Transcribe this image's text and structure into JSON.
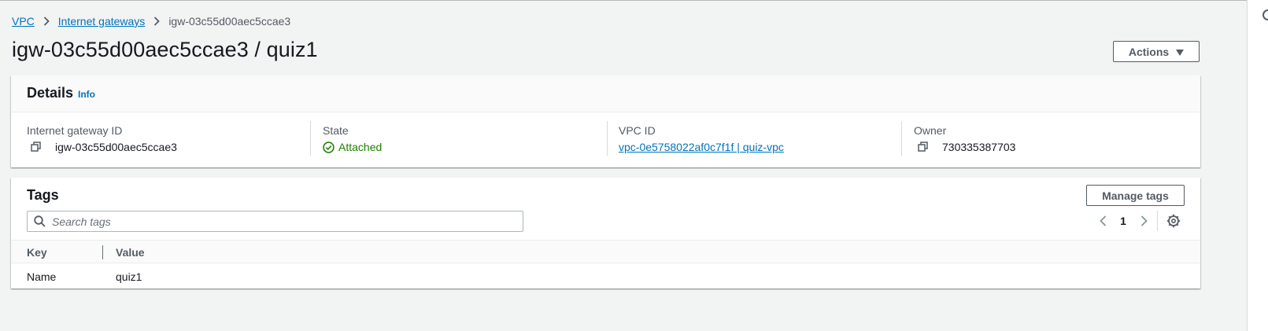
{
  "breadcrumb": {
    "items": [
      {
        "label": "VPC"
      },
      {
        "label": "Internet gateways"
      },
      {
        "label": "igw-03c55d00aec5ccae3"
      }
    ]
  },
  "page": {
    "title": "igw-03c55d00aec5ccae3 / quiz1",
    "actions_label": "Actions"
  },
  "details": {
    "title": "Details",
    "info_label": "Info",
    "columns": [
      {
        "label": "Internet gateway ID",
        "value": "igw-03c55d00aec5ccae3",
        "icon": "copy-icon"
      },
      {
        "label": "State",
        "value": "Attached",
        "icon": "status-positive-icon"
      },
      {
        "label": "VPC ID",
        "value": "vpc-0e5758022af0c7f1f | quiz-vpc"
      },
      {
        "label": "Owner",
        "value": "730335387703",
        "icon": "copy-icon"
      }
    ]
  },
  "tags": {
    "title": "Tags",
    "manage_label": "Manage tags",
    "search_placeholder": "Search tags",
    "search_value": "",
    "page_number": "1",
    "headers": [
      "Key",
      "Value"
    ],
    "rows": [
      {
        "key": "Name",
        "value": "quiz1"
      }
    ]
  },
  "colors": {
    "link": "#0073bb",
    "success": "#1d8102",
    "text": "#16191f",
    "muted": "#545b64",
    "background": "#f2f3f3"
  }
}
